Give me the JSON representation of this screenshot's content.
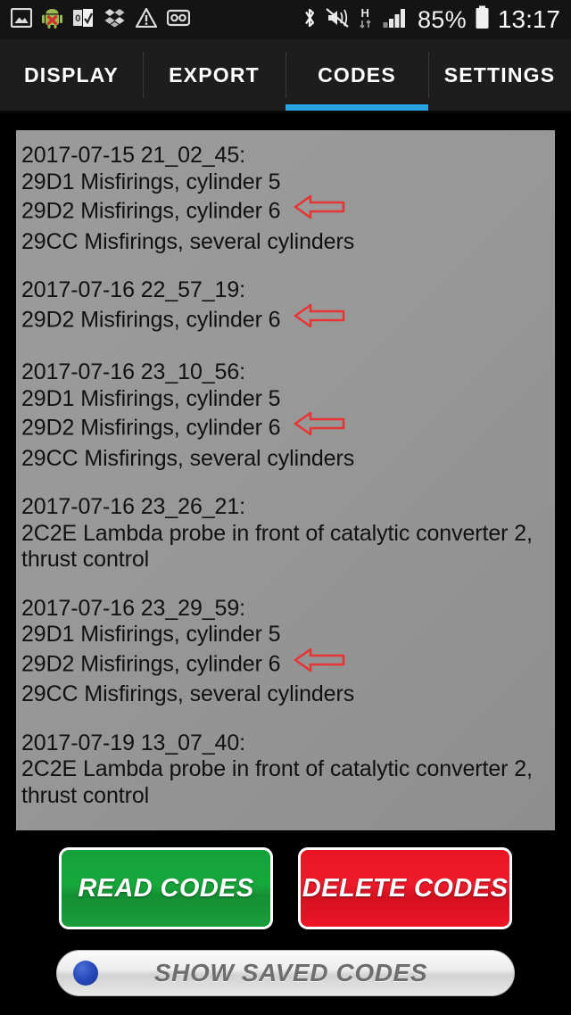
{
  "statusbar": {
    "left_icons": [
      "image-broken-icon",
      "android-error-icon",
      "email-icon",
      "dropbox-icon",
      "warning-icon",
      "voicemail-icon"
    ],
    "right_icons": [
      "bluetooth-icon",
      "mute-vibrate-icon",
      "hspa-h-icon",
      "signal-bars-icon",
      "battery-icon"
    ],
    "network_label": "H",
    "battery_percent": "85%",
    "clock": "13:17"
  },
  "tabs": [
    {
      "label": "DISPLAY",
      "active": false
    },
    {
      "label": "EXPORT",
      "active": false
    },
    {
      "label": "CODES",
      "active": true
    },
    {
      "label": "SETTINGS",
      "active": false
    }
  ],
  "accent_color": "#2aa4e0",
  "codes": {
    "blocks": [
      {
        "timestamp": "2017-07-15 21_02_45:",
        "lines": [
          {
            "text": "29D1 Misfirings, cylinder 5",
            "arrow": false
          },
          {
            "text": "29D2 Misfirings, cylinder 6",
            "arrow": true
          },
          {
            "text": "29CC Misfirings, several cylinders",
            "arrow": false
          }
        ]
      },
      {
        "timestamp": "2017-07-16 22_57_19:",
        "lines": [
          {
            "text": "29D2 Misfirings, cylinder 6",
            "arrow": true
          }
        ]
      },
      {
        "timestamp": "2017-07-16 23_10_56:",
        "lines": [
          {
            "text": "29D1 Misfirings, cylinder 5",
            "arrow": false
          },
          {
            "text": "29D2 Misfirings, cylinder 6",
            "arrow": true
          },
          {
            "text": "29CC Misfirings, several cylinders",
            "arrow": false
          }
        ]
      },
      {
        "timestamp": "2017-07-16 23_26_21:",
        "lines": [
          {
            "text": "2C2E Lambda probe in front of catalytic converter 2, thrust control",
            "arrow": false,
            "wrap": true
          }
        ]
      },
      {
        "timestamp": "2017-07-16 23_29_59:",
        "lines": [
          {
            "text": "29D1 Misfirings, cylinder 5",
            "arrow": false
          },
          {
            "text": "29D2 Misfirings, cylinder 6",
            "arrow": true
          },
          {
            "text": "29CC Misfirings, several cylinders",
            "arrow": false
          }
        ]
      },
      {
        "timestamp": "2017-07-19 13_07_40:",
        "lines": [
          {
            "text": "2C2E Lambda probe in front of catalytic converter 2, thrust control",
            "arrow": false,
            "wrap": true
          }
        ]
      }
    ],
    "arrow_color": "#e83434"
  },
  "actions": {
    "read_label": "READ CODES",
    "delete_label": "DELETE CODES",
    "read_color": "#17a83c",
    "delete_color": "#ee1526"
  },
  "saved": {
    "label": "SHOW SAVED CODES",
    "radio_selected": true,
    "radio_color": "#2446b8"
  }
}
